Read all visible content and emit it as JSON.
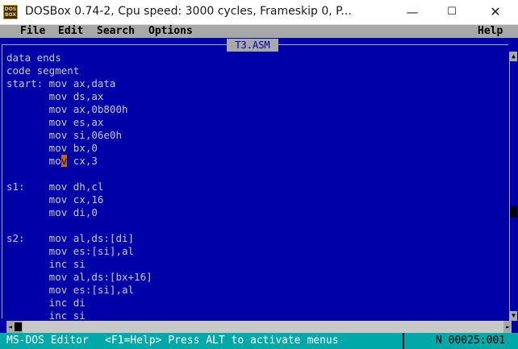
{
  "window": {
    "title": "DOSBox 0.74-2, Cpu speed:    3000 cycles, Frameskip  0, P...",
    "icon_text": "DOS BOX",
    "minimize_icon": "minimize-icon",
    "maximize_icon": "maximize-icon",
    "close_icon": "close-icon"
  },
  "menu": {
    "file": "File",
    "edit": "Edit",
    "search": "Search",
    "options": "Options",
    "help": "Help"
  },
  "editor": {
    "filename": "T3.ASM",
    "lines": [
      "data ends",
      "code segment",
      "start: mov ax,data",
      "       mov ds,ax",
      "       mov ax,0b800h",
      "       mov es,ax",
      "       mov si,06e0h",
      "       mov bx,0",
      "       mov cx,3",
      "",
      "s1:    mov dh,cl",
      "       mov cx,16",
      "       mov di,0",
      "",
      "s2:    mov al,ds:[di]",
      "       mov es:[si],al",
      "       inc si",
      "       mov al,ds:[bx+16]",
      "       mov es:[si],al",
      "       inc di",
      "       inc si"
    ],
    "cursor_line": 8,
    "cursor_col": 9
  },
  "status": {
    "program": "MS-DOS Editor",
    "hint": "<F1=Help> Press ALT to activate menus",
    "position": "N 00025:001"
  },
  "colors": {
    "editor_bg": "#0000a8",
    "menu_bg": "#a8a8a8",
    "status_bg": "#00a8a8",
    "cursor": "#c86400"
  }
}
